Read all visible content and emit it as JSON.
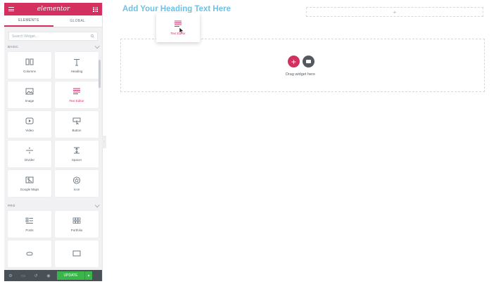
{
  "sidebar": {
    "logo": "elementor",
    "tabs": [
      {
        "label": "ELEMENTS"
      },
      {
        "label": "GLOBAL"
      }
    ],
    "search_placeholder": "Search Widget...",
    "sections": {
      "basic": "BASIC",
      "pro": "PRO"
    },
    "widgets": [
      {
        "label": "Columns",
        "icon": "columns-icon"
      },
      {
        "label": "Heading",
        "icon": "heading-icon"
      },
      {
        "label": "Image",
        "icon": "image-icon"
      },
      {
        "label": "Text Editor",
        "icon": "text-editor-icon"
      },
      {
        "label": "Video",
        "icon": "video-icon"
      },
      {
        "label": "Button",
        "icon": "button-icon"
      },
      {
        "label": "Divider",
        "icon": "divider-icon"
      },
      {
        "label": "Spacer",
        "icon": "spacer-icon"
      },
      {
        "label": "Google Maps",
        "icon": "google-maps-icon"
      },
      {
        "label": "Icon",
        "icon": "star-icon"
      }
    ],
    "pro_widgets": [
      {
        "label": "Posts",
        "icon": "posts-icon"
      },
      {
        "label": "Portfolio",
        "icon": "portfolio-icon"
      }
    ],
    "footer": {
      "update_label": "UPDATE"
    }
  },
  "canvas": {
    "heading": "Add Your Heading Text Here",
    "drop_text": "Drag widget here",
    "dragging_widget": "Text Editor"
  },
  "colors": {
    "brand": "#d4305f",
    "heading": "#6ec1e4",
    "update": "#39b54a"
  }
}
